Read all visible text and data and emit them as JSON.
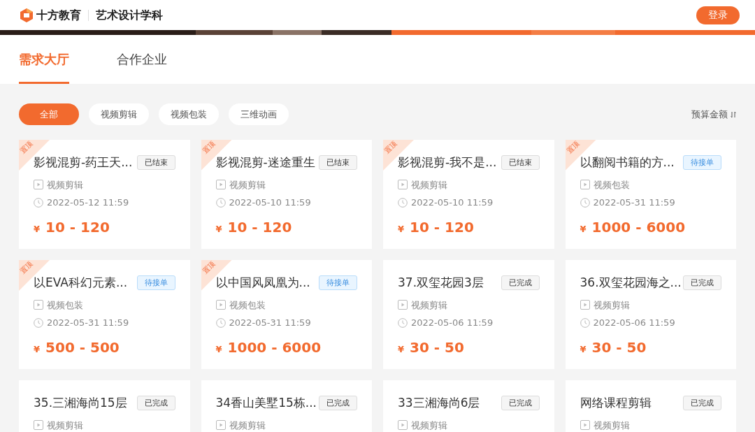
{
  "header": {
    "brand": "十方教育",
    "subject": "艺术设计学科",
    "login": "登录"
  },
  "tabs": [
    {
      "label": "需求大厅",
      "selected": true
    },
    {
      "label": "合作企业",
      "selected": false
    }
  ],
  "filters": [
    {
      "label": "全部",
      "selected": true
    },
    {
      "label": "视频剪辑",
      "selected": false
    },
    {
      "label": "视频包装",
      "selected": false
    },
    {
      "label": "三维动画",
      "selected": false
    }
  ],
  "sort": {
    "label": "预算金额"
  },
  "cards": [
    {
      "pinned": true,
      "pinned_label": "置顶",
      "title": "影视混剪-药王天...",
      "status": {
        "kind": "ended",
        "label": "已结束"
      },
      "category": "视频剪辑",
      "date": "2022-05-12 11:59",
      "currency": "¥",
      "price": "10 - 120"
    },
    {
      "pinned": true,
      "pinned_label": "置顶",
      "title": "影视混剪-迷途重生",
      "status": {
        "kind": "ended",
        "label": "已结束"
      },
      "category": "视频剪辑",
      "date": "2022-05-10 11:59",
      "currency": "¥",
      "price": "10 - 120"
    },
    {
      "pinned": true,
      "pinned_label": "置顶",
      "title": "影视混剪-我不是...",
      "status": {
        "kind": "ended",
        "label": "已结束"
      },
      "category": "视频剪辑",
      "date": "2022-05-10 11:59",
      "currency": "¥",
      "price": "10 - 120"
    },
    {
      "pinned": true,
      "pinned_label": "置顶",
      "title": "以翻阅书籍的方...",
      "status": {
        "kind": "pending",
        "label": "待接单"
      },
      "category": "视频包装",
      "date": "2022-05-31 11:59",
      "currency": "¥",
      "price": "1000 - 6000"
    },
    {
      "pinned": true,
      "pinned_label": "置顶",
      "title": "以EVA科幻元素...",
      "status": {
        "kind": "pending",
        "label": "待接单"
      },
      "category": "视频包装",
      "date": "2022-05-31 11:59",
      "currency": "¥",
      "price": "500 - 500"
    },
    {
      "pinned": true,
      "pinned_label": "置顶",
      "title": "以中国风凤凰为...",
      "status": {
        "kind": "pending",
        "label": "待接单"
      },
      "category": "视频包装",
      "date": "2022-05-31 11:59",
      "currency": "¥",
      "price": "1000 - 6000"
    },
    {
      "pinned": false,
      "title": "37.双玺花园3层",
      "status": {
        "kind": "done",
        "label": "已完成"
      },
      "category": "视频剪辑",
      "date": "2022-05-06 11:59",
      "currency": "¥",
      "price": "30 - 50"
    },
    {
      "pinned": false,
      "title": "36.双玺花园海之...",
      "status": {
        "kind": "done",
        "label": "已完成"
      },
      "category": "视频剪辑",
      "date": "2022-05-06 11:59",
      "currency": "¥",
      "price": "30 - 50"
    },
    {
      "pinned": false,
      "title": "35.三湘海尚15层",
      "status": {
        "kind": "done",
        "label": "已完成"
      },
      "category": "视频剪辑"
    },
    {
      "pinned": false,
      "title": "34香山美墅15栋...",
      "status": {
        "kind": "done",
        "label": "已完成"
      },
      "category": "视频剪辑"
    },
    {
      "pinned": false,
      "title": "33三湘海尚6层",
      "status": {
        "kind": "done",
        "label": "已完成"
      },
      "category": "视频剪辑"
    },
    {
      "pinned": false,
      "title": "网络课程剪辑",
      "status": {
        "kind": "done",
        "label": "已完成"
      },
      "category": "视频剪辑"
    }
  ]
}
